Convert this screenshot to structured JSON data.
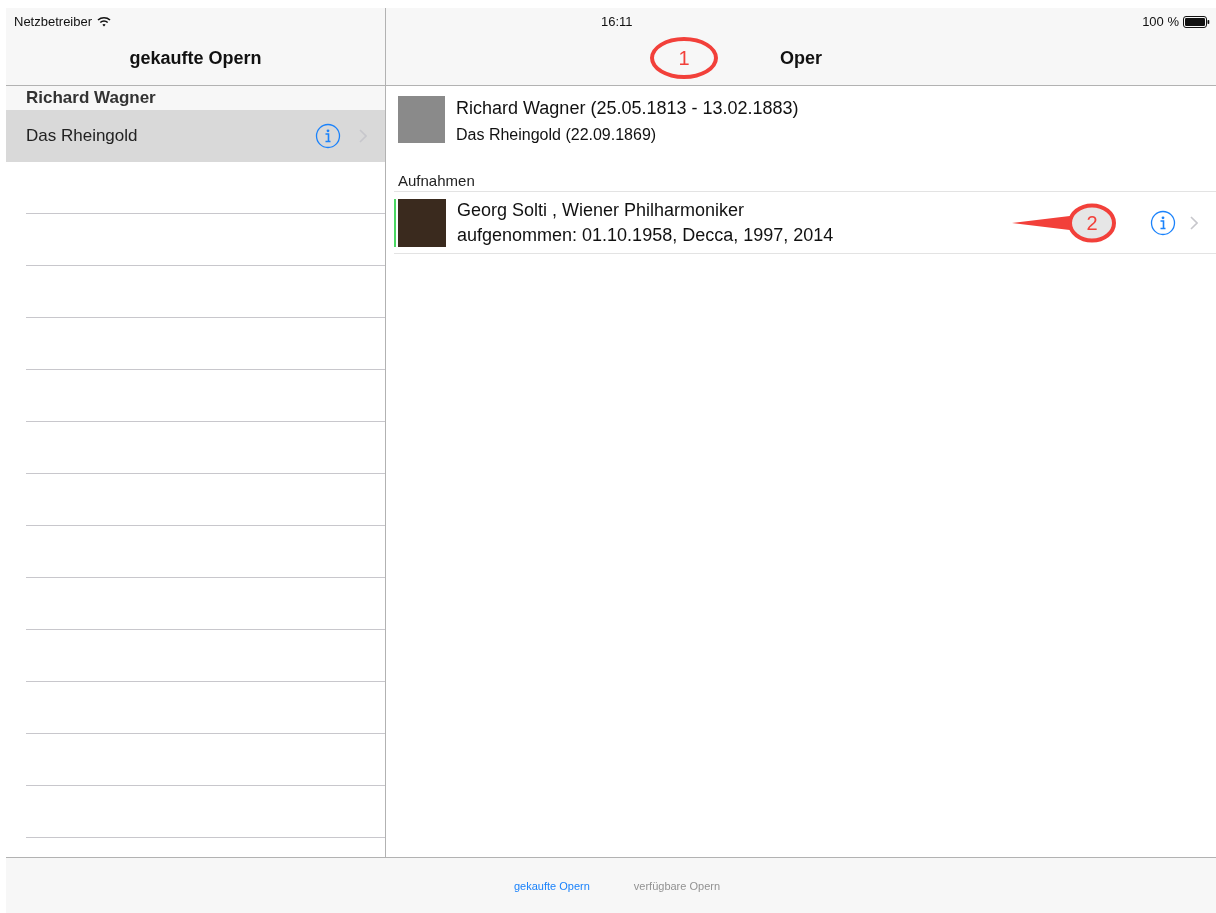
{
  "status_bar": {
    "carrier": "Netzbetreiber",
    "time": "16:11",
    "battery": "100 %"
  },
  "master": {
    "title": "gekaufte Opern",
    "sections": [
      {
        "header": "Richard Wagner",
        "rows": [
          {
            "title": "Das Rheingold",
            "selected": true
          }
        ]
      }
    ]
  },
  "detail": {
    "title": "Oper",
    "composer": {
      "name": "Richard Wagner (25.05.1813 - 13.02.1883)",
      "opera": "Das Rheingold (22.09.1869)"
    },
    "section_header": "Aufnahmen",
    "recordings": [
      {
        "performers": "Georg Solti , Wiener Philharmoniker",
        "details": "aufgenommen: 01.10.1958, Decca, 1997, 2014",
        "color": "#4cd964"
      }
    ]
  },
  "tab_bar": [
    {
      "label": "gekaufte Opern",
      "selected": true
    },
    {
      "label": "verfügbare Opern",
      "selected": false
    }
  ],
  "annotations": [
    {
      "kind": "ellipse",
      "label": "1"
    },
    {
      "kind": "callout",
      "label": "2"
    }
  ]
}
